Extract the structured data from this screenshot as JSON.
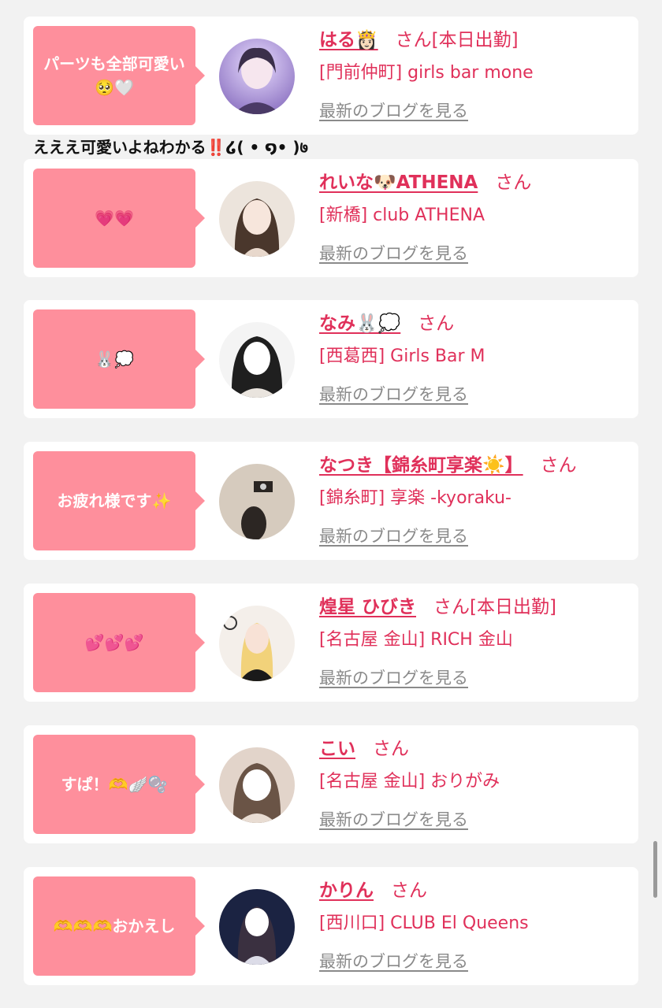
{
  "comment": "えええ可愛いよねわかる‼️໒( • ໑• )७",
  "cards": [
    {
      "bubble": "パーツも全部可愛い🥺🤍",
      "name": "はる👸🏻",
      "suffix": "さん[本日出勤]",
      "shop": "[門前仲町] girls bar mone",
      "blog": "最新のブログを見る",
      "avatar_colors": [
        "#c9b6f0",
        "#4a3a66"
      ]
    },
    {
      "bubble": "💗💗",
      "name": "れいな🐶ATHENA",
      "suffix": "さん",
      "shop": "[新橋] club ATHENA",
      "blog": "最新のブログを見る",
      "avatar_colors": [
        "#e8ddd4",
        "#5a4438"
      ]
    },
    {
      "bubble": "🐰💭",
      "name": "なみ🐰💭",
      "suffix": "さん",
      "shop": "[西葛西] Girls Bar M",
      "blog": "最新のブログを見る",
      "avatar_colors": [
        "#f2f2f2",
        "#2a2a2a"
      ]
    },
    {
      "bubble": "お疲れ様です✨",
      "name": "なつき【錦糸町享楽☀️】",
      "suffix": "さん",
      "shop": "[錦糸町] 享楽 -kyoraku-",
      "blog": "最新のブログを見る",
      "avatar_colors": [
        "#d8cfc4",
        "#3a332e"
      ]
    },
    {
      "bubble": "💕💕💕",
      "name": "煌星 ひびき",
      "suffix": "さん[本日出勤]",
      "shop": "[名古屋 金山] RICH 金山",
      "blog": "最新のブログを見る",
      "avatar_colors": [
        "#f5f0ec",
        "#1e1e1e"
      ]
    },
    {
      "bubble": "すぱ！🫶🪽🫧",
      "name": "こい",
      "suffix": "さん",
      "shop": "[名古屋 金山] おりがみ",
      "blog": "最新のブログを見る",
      "avatar_colors": [
        "#e4d6cc",
        "#5c4a40"
      ]
    },
    {
      "bubble": "🫶🫶🫶おかえし",
      "name": "かりん",
      "suffix": "さん",
      "shop": "[西川口] CLUB El Queens",
      "blog": "最新のブログを見る",
      "avatar_colors": [
        "#1a2240",
        "#d8d8e4"
      ]
    }
  ]
}
